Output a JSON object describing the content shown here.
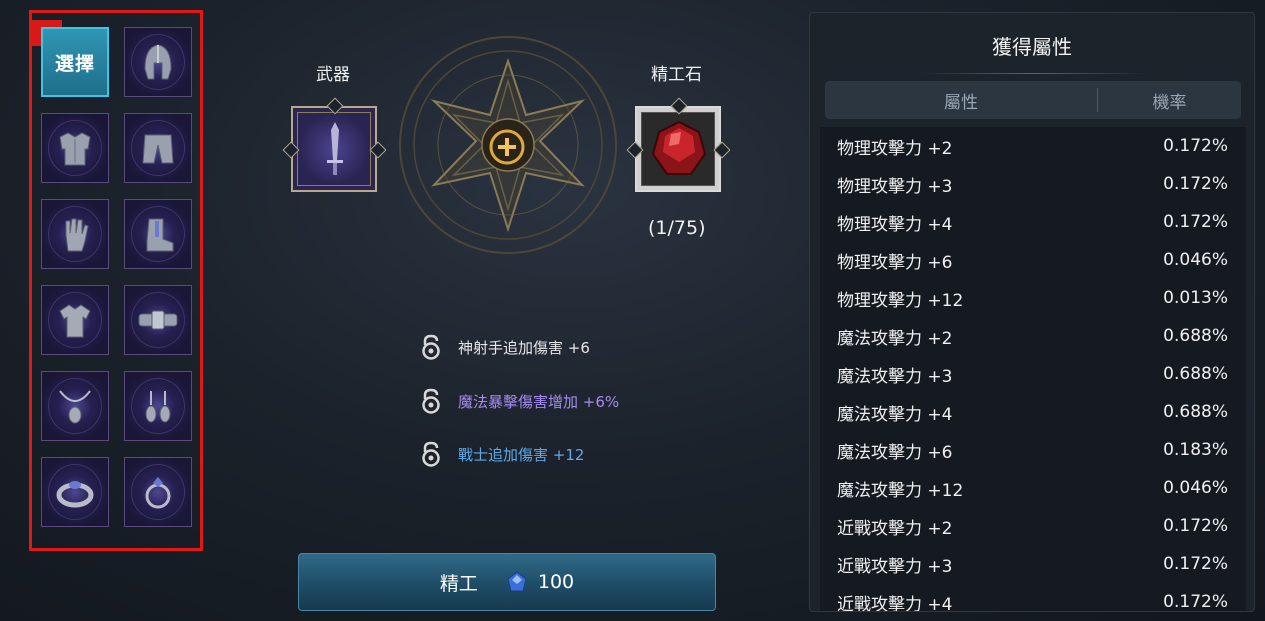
{
  "annotation": {
    "number": "1"
  },
  "slots": {
    "select_label": "選擇",
    "items": [
      {
        "name": "slot-weapon",
        "icon": "select-icon"
      },
      {
        "name": "slot-helmet",
        "icon": "helmet-icon"
      },
      {
        "name": "slot-armor",
        "icon": "armor-icon"
      },
      {
        "name": "slot-pants",
        "icon": "pants-icon"
      },
      {
        "name": "slot-gloves",
        "icon": "gloves-icon"
      },
      {
        "name": "slot-boots",
        "icon": "boots-icon"
      },
      {
        "name": "slot-shirt",
        "icon": "shirt-icon"
      },
      {
        "name": "slot-belt",
        "icon": "belt-icon"
      },
      {
        "name": "slot-necklace",
        "icon": "necklace-icon"
      },
      {
        "name": "slot-earrings",
        "icon": "earrings-icon"
      },
      {
        "name": "slot-bracelet",
        "icon": "bracelet-icon"
      },
      {
        "name": "slot-ring",
        "icon": "ring-icon"
      }
    ]
  },
  "craft": {
    "weapon_label": "武器",
    "stone_label": "精工石",
    "stone_count": "(1/75)",
    "options": [
      {
        "text": "神射手追加傷害 +6",
        "color": "#e6e6e6"
      },
      {
        "text": "魔法暴擊傷害增加 +6%",
        "color": "#a58cf0"
      },
      {
        "text": "戰士追加傷害 +12",
        "color": "#5fa8e8"
      }
    ],
    "button_label": "精工",
    "button_cost": "100"
  },
  "panel": {
    "title": "獲得屬性",
    "col_attr": "屬性",
    "col_rate": "機率",
    "rows": [
      {
        "attr": "物理攻擊力 +2",
        "rate": "0.172%"
      },
      {
        "attr": "物理攻擊力 +3",
        "rate": "0.172%"
      },
      {
        "attr": "物理攻擊力 +4",
        "rate": "0.172%"
      },
      {
        "attr": "物理攻擊力 +6",
        "rate": "0.046%"
      },
      {
        "attr": "物理攻擊力 +12",
        "rate": "0.013%"
      },
      {
        "attr": "魔法攻擊力 +2",
        "rate": "0.688%"
      },
      {
        "attr": "魔法攻擊力 +3",
        "rate": "0.688%"
      },
      {
        "attr": "魔法攻擊力 +4",
        "rate": "0.688%"
      },
      {
        "attr": "魔法攻擊力 +6",
        "rate": "0.183%"
      },
      {
        "attr": "魔法攻擊力 +12",
        "rate": "0.046%"
      },
      {
        "attr": "近戰攻擊力 +2",
        "rate": "0.172%"
      },
      {
        "attr": "近戰攻擊力 +3",
        "rate": "0.172%"
      },
      {
        "attr": "近戰攻擊力 +4",
        "rate": "0.172%"
      }
    ]
  },
  "colors": {
    "accent": "#3fc4e8",
    "annotation": "#e01818",
    "craft_button": "#2f6a88"
  }
}
